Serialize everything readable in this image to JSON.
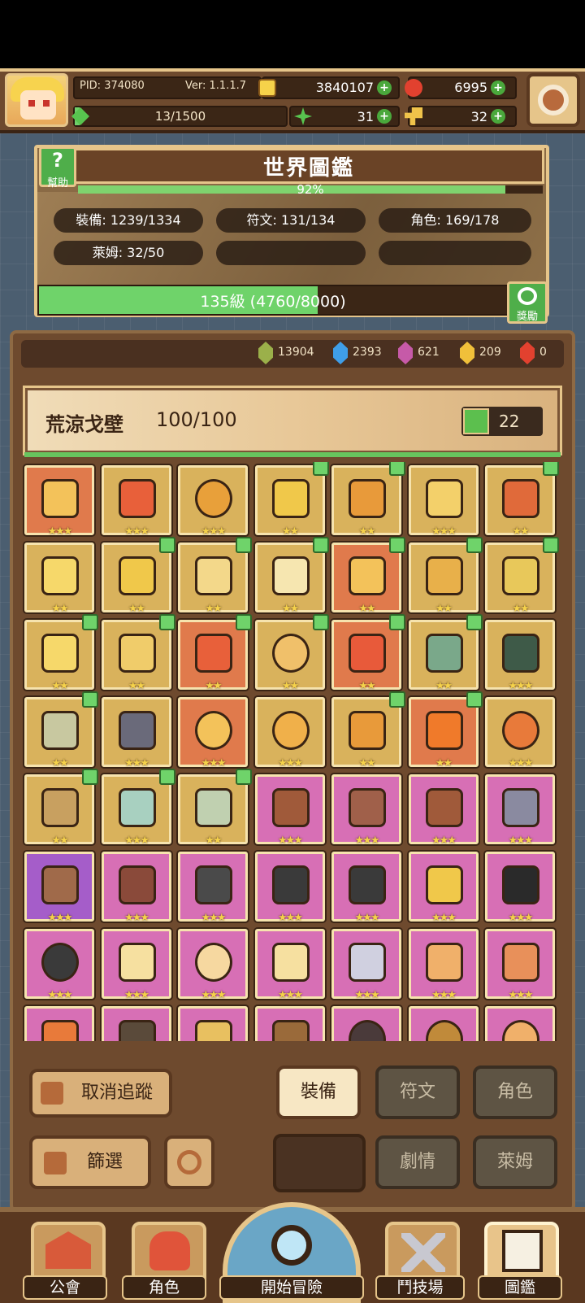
{
  "player": {
    "pid_text": "PID: 374080",
    "version_text": "Ver: 1.1.1.7",
    "exp_text": "13/1500",
    "exp_fraction": 0.0087
  },
  "currencies": {
    "gold": "3840107",
    "red_gem": "6995",
    "clover": "31",
    "key": "32",
    "colors": {
      "gold": "#f6d24a",
      "red_gem": "#e2412f",
      "clover": "#58c44f",
      "key": "#f0c34a"
    }
  },
  "world": {
    "help_label": "幫助",
    "title": "世界圖鑑",
    "percent_text": "92%",
    "percent": 0.92,
    "stats": [
      {
        "label": "裝備: 1239/1334"
      },
      {
        "label": "符文: 131/134"
      },
      {
        "label": "角色: 169/178"
      },
      {
        "label": "萊姆: 32/50"
      },
      {
        "label": ""
      },
      {
        "label": ""
      }
    ],
    "level_text": "135級 (4760/8000)",
    "level_fraction": 0.595,
    "reward_label": "獎勵"
  },
  "gems": [
    {
      "value": "13904",
      "color": "#9bb04a"
    },
    {
      "value": "2393",
      "color": "#3f9ee8"
    },
    {
      "value": "621",
      "color": "#c65aa8"
    },
    {
      "value": "209",
      "color": "#f0c03a"
    },
    {
      "value": "0",
      "color": "#e2412f"
    }
  ],
  "zone": {
    "name": "荒涼戈壁",
    "progress": "100/100",
    "likes": "22"
  },
  "items": [
    {
      "bg": "orange",
      "stars": 3,
      "thumb": false,
      "icon": "heart-necklace-icon",
      "color": "#f3c25a"
    },
    {
      "bg": "gold",
      "stars": 3,
      "thumb": false,
      "icon": "gauntlet-icon",
      "color": "#e8603a"
    },
    {
      "bg": "gold",
      "stars": 3,
      "thumb": false,
      "icon": "ring-icon",
      "color": "#e8a03a"
    },
    {
      "bg": "gold",
      "stars": 2,
      "thumb": true,
      "icon": "necklace-icon",
      "color": "#f0c84a"
    },
    {
      "bg": "gold",
      "stars": 2,
      "thumb": true,
      "icon": "spear-icon",
      "color": "#e89a3a"
    },
    {
      "bg": "gold",
      "stars": 3,
      "thumb": false,
      "icon": "helmet-icon",
      "color": "#f3d06a"
    },
    {
      "bg": "gold",
      "stars": 2,
      "thumb": true,
      "icon": "armor-icon",
      "color": "#e06a3a"
    },
    {
      "bg": "gold",
      "stars": 2,
      "thumb": false,
      "icon": "mace-icon",
      "color": "#f6d86a"
    },
    {
      "bg": "gold",
      "stars": 2,
      "thumb": true,
      "icon": "crown-icon",
      "color": "#f0c84a"
    },
    {
      "bg": "gold",
      "stars": 2,
      "thumb": true,
      "icon": "armor-icon",
      "color": "#f3d88a"
    },
    {
      "bg": "gold",
      "stars": 2,
      "thumb": true,
      "icon": "star-gem-icon",
      "color": "#f6e6b0"
    },
    {
      "bg": "orange",
      "stars": 2,
      "thumb": true,
      "icon": "pendant-icon",
      "color": "#f3c25a"
    },
    {
      "bg": "gold",
      "stars": 2,
      "thumb": true,
      "icon": "helmet-icon",
      "color": "#e8b04a"
    },
    {
      "bg": "gold",
      "stars": 2,
      "thumb": true,
      "icon": "gauntlet-icon",
      "color": "#e8c85a"
    },
    {
      "bg": "gold",
      "stars": 2,
      "thumb": true,
      "icon": "wing-icon",
      "color": "#f6d86a"
    },
    {
      "bg": "gold",
      "stars": 2,
      "thumb": true,
      "icon": "shield-icon",
      "color": "#f0cc6a"
    },
    {
      "bg": "orange",
      "stars": 2,
      "thumb": true,
      "icon": "necklace-icon",
      "color": "#e8603a"
    },
    {
      "bg": "gold",
      "stars": 2,
      "thumb": true,
      "icon": "ring-icon",
      "color": "#f0c06a"
    },
    {
      "bg": "orange",
      "stars": 2,
      "thumb": true,
      "icon": "belt-icon",
      "color": "#e85a3a"
    },
    {
      "bg": "gold",
      "stars": 2,
      "thumb": true,
      "icon": "sword-icon",
      "color": "#7aa88a"
    },
    {
      "bg": "gold",
      "stars": 3,
      "thumb": false,
      "icon": "hood-icon",
      "color": "#3e5a48"
    },
    {
      "bg": "gold",
      "stars": 2,
      "thumb": true,
      "icon": "claw-icon",
      "color": "#c8c8a0"
    },
    {
      "bg": "gold",
      "stars": 3,
      "thumb": false,
      "icon": "dagger-icon",
      "color": "#6a6a7a"
    },
    {
      "bg": "orange",
      "stars": 3,
      "thumb": false,
      "icon": "ring-icon",
      "color": "#f3c25a"
    },
    {
      "bg": "gold",
      "stars": 3,
      "thumb": false,
      "icon": "amulet-icon",
      "color": "#f0b04a"
    },
    {
      "bg": "gold",
      "stars": 2,
      "thumb": true,
      "icon": "arrow-icon",
      "color": "#e89a3a"
    },
    {
      "bg": "orange",
      "stars": 2,
      "thumb": true,
      "icon": "gem-icon",
      "color": "#f07a2a"
    },
    {
      "bg": "gold",
      "stars": 3,
      "thumb": false,
      "icon": "ring-icon",
      "color": "#e87a3a"
    },
    {
      "bg": "gold",
      "stars": 2,
      "thumb": true,
      "icon": "bow-icon",
      "color": "#c8a060"
    },
    {
      "bg": "gold",
      "stars": 3,
      "thumb": true,
      "icon": "armor-icon",
      "color": "#a8d0c0"
    },
    {
      "bg": "gold",
      "stars": 2,
      "thumb": true,
      "icon": "boots-icon",
      "color": "#c0d0b0"
    },
    {
      "bg": "pink",
      "stars": 3,
      "thumb": false,
      "icon": "necklace-icon",
      "color": "#a05a3a"
    },
    {
      "bg": "pink",
      "stars": 3,
      "thumb": false,
      "icon": "armor-icon",
      "color": "#a0604a"
    },
    {
      "bg": "pink",
      "stars": 3,
      "thumb": false,
      "icon": "boots-icon",
      "color": "#a05a3a"
    },
    {
      "bg": "pink",
      "stars": 3,
      "thumb": false,
      "icon": "gun-icon",
      "color": "#8a8aa0"
    },
    {
      "bg": "purple",
      "stars": 3,
      "thumb": false,
      "icon": "boot-icon",
      "color": "#a06a4a"
    },
    {
      "bg": "pink",
      "stars": 3,
      "thumb": false,
      "icon": "belt-icon",
      "color": "#8a4a3a"
    },
    {
      "bg": "pink",
      "stars": 3,
      "thumb": false,
      "icon": "helmet-icon",
      "color": "#4a4a4a"
    },
    {
      "bg": "pink",
      "stars": 3,
      "thumb": false,
      "icon": "armor-icon",
      "color": "#3a3a3a"
    },
    {
      "bg": "pink",
      "stars": 3,
      "thumb": false,
      "icon": "gauntlet-icon",
      "color": "#3a3a3a"
    },
    {
      "bg": "pink",
      "stars": 3,
      "thumb": false,
      "icon": "star-gem-icon",
      "color": "#f0c84a"
    },
    {
      "bg": "pink",
      "stars": 3,
      "thumb": false,
      "icon": "necklace-icon",
      "color": "#2a2a2a"
    },
    {
      "bg": "pink",
      "stars": 3,
      "thumb": false,
      "icon": "ring-icon",
      "color": "#3a3a3a"
    },
    {
      "bg": "pink",
      "stars": 3,
      "thumb": false,
      "icon": "pendant-icon",
      "color": "#f6e0a0"
    },
    {
      "bg": "pink",
      "stars": 3,
      "thumb": false,
      "icon": "ring-icon",
      "color": "#f6d8a0"
    },
    {
      "bg": "pink",
      "stars": 3,
      "thumb": false,
      "icon": "star-gem-icon",
      "color": "#f6e0a0"
    },
    {
      "bg": "pink",
      "stars": 3,
      "thumb": false,
      "icon": "sword-icon",
      "color": "#d0d0e0"
    },
    {
      "bg": "pink",
      "stars": 3,
      "thumb": false,
      "icon": "shield-icon",
      "color": "#f0b06a"
    },
    {
      "bg": "pink",
      "stars": 3,
      "thumb": false,
      "icon": "armor-icon",
      "color": "#e8905a"
    },
    {
      "bg": "pink",
      "stars": 3,
      "thumb": false,
      "icon": "gem-icon",
      "color": "#e87a3a"
    },
    {
      "bg": "pink",
      "stars": 3,
      "thumb": false,
      "icon": "armor-icon",
      "color": "#5a4a3a"
    },
    {
      "bg": "pink",
      "stars": 3,
      "thumb": false,
      "icon": "hood-icon",
      "color": "#e8c060"
    },
    {
      "bg": "pink",
      "stars": 3,
      "thumb": false,
      "icon": "helmet-icon",
      "color": "#9a6a3a"
    },
    {
      "bg": "pink",
      "stars": 3,
      "thumb": false,
      "icon": "ring-icon",
      "color": "#4a3a3a"
    },
    {
      "bg": "pink",
      "stars": 3,
      "thumb": false,
      "icon": "ring-icon",
      "color": "#c08a3a"
    },
    {
      "bg": "pink",
      "stars": 3,
      "thumb": false,
      "icon": "amulet-icon",
      "color": "#f0b06a"
    }
  ],
  "controls": {
    "untrack_label": "取消追蹤",
    "filter_label": "篩選",
    "tabs": {
      "equipment": "裝備",
      "rune": "符文",
      "character": "角色",
      "story": "劇情",
      "slime": "萊姆"
    }
  },
  "nav": {
    "guild": "公會",
    "character": "角色",
    "adventure": "開始冒險",
    "arena": "鬥技場",
    "codex": "圖鑑"
  }
}
